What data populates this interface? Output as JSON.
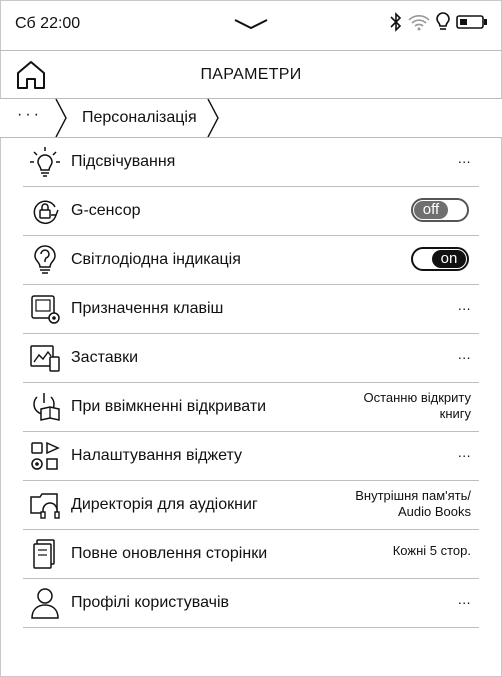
{
  "status": {
    "time": "Сб 22:00"
  },
  "header": {
    "title": "ПАРАМЕТРИ"
  },
  "breadcrumb": {
    "more": "···",
    "current": "Персоналізація"
  },
  "items": [
    {
      "label": "Підсвічування",
      "value": "...",
      "icon": "bulb-sun-icon"
    },
    {
      "label": "G-сенсор",
      "toggle": "off",
      "icon": "rotate-lock-icon"
    },
    {
      "label": "Світлодіодна індикація",
      "toggle": "on",
      "icon": "led-question-icon"
    },
    {
      "label": "Призначення клавіш",
      "value": "...",
      "icon": "keys-gear-icon"
    },
    {
      "label": "Заставки",
      "value": "...",
      "icon": "screensaver-icon"
    },
    {
      "label": "При ввімкненні відкривати",
      "value_lines": [
        "Останню відкриту",
        "книгу"
      ],
      "icon": "power-book-icon"
    },
    {
      "label": "Налаштування віджету",
      "value": "...",
      "icon": "widget-icon"
    },
    {
      "label": "Директорія для аудіокниг",
      "value_lines": [
        "Внутрішня пам'ять/",
        "Audio Books"
      ],
      "icon": "folder-headphones-icon"
    },
    {
      "label": "Повне оновлення сторінки",
      "value": "Кожні 5 стор.",
      "icon": "page-refresh-icon"
    },
    {
      "label": "Профілі користувачів",
      "value": "...",
      "icon": "user-icon"
    }
  ]
}
